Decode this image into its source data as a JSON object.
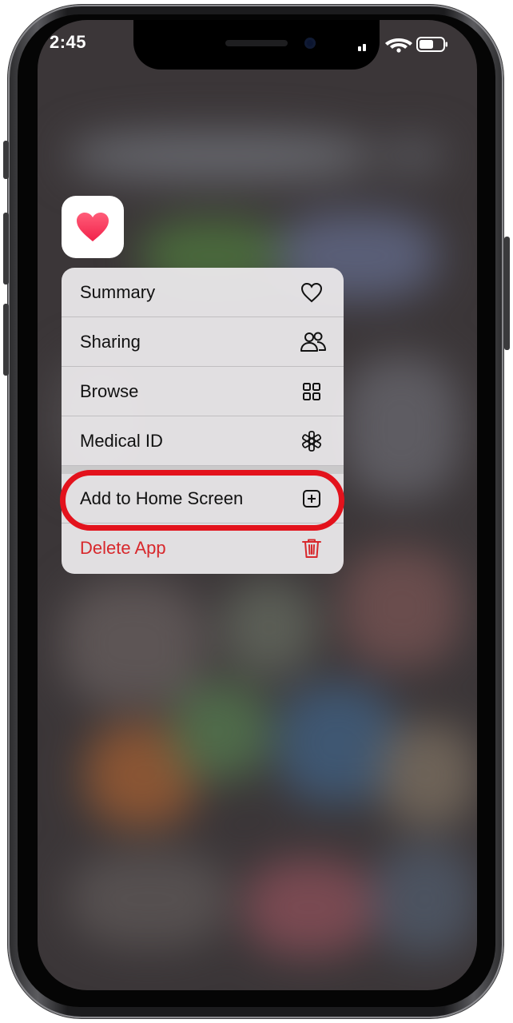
{
  "status_bar": {
    "time": "2:45"
  },
  "app": {
    "icon": "heart-icon",
    "icon_color": "#f2314f"
  },
  "menu": {
    "items": [
      {
        "label": "Summary",
        "icon": "heart-outline-icon"
      },
      {
        "label": "Sharing",
        "icon": "people-icon"
      },
      {
        "label": "Browse",
        "icon": "grid-icon"
      },
      {
        "label": "Medical ID",
        "icon": "asterisk-icon"
      },
      {
        "label": "Add to Home Screen",
        "icon": "plus-square-icon"
      },
      {
        "label": "Delete App",
        "icon": "trash-icon",
        "destructive": true
      }
    ]
  },
  "colors": {
    "destructive": "#d8282c",
    "highlight_ring": "#e3121c"
  }
}
